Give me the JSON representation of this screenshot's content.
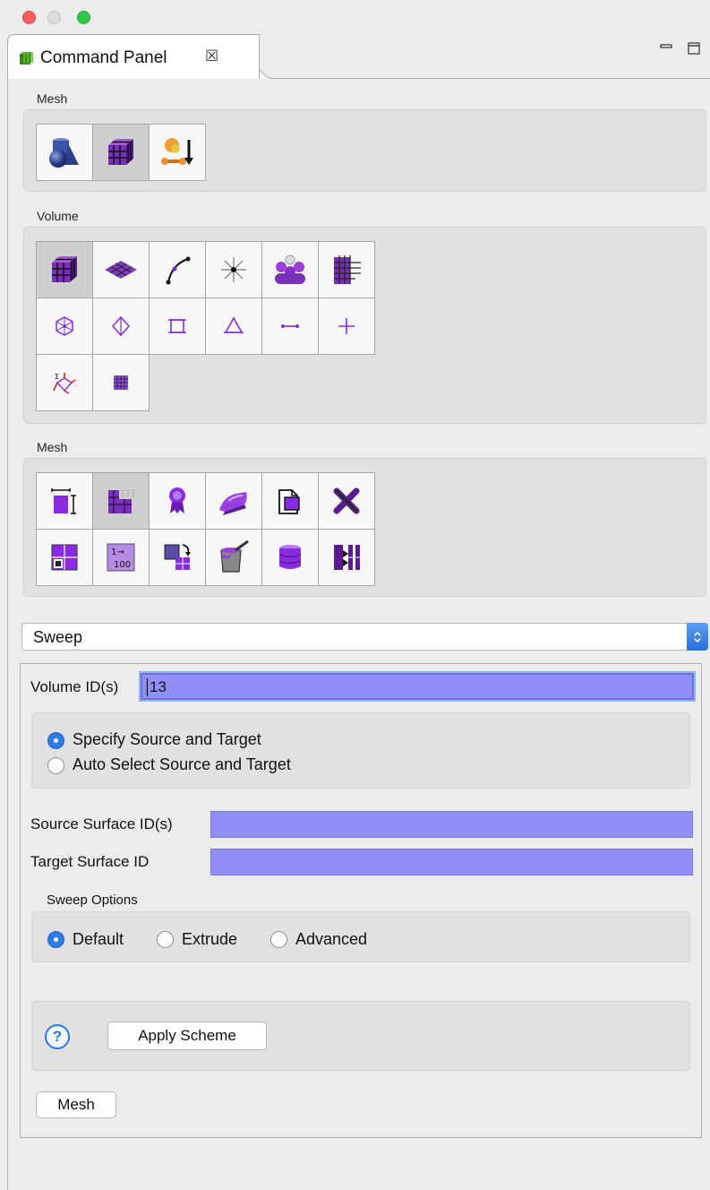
{
  "window": {
    "tab_title": "Command Panel",
    "tab_close_glyph": "☒"
  },
  "sections": {
    "top_label": "Mesh",
    "volume_label": "Volume",
    "mesh_label": "Mesh"
  },
  "toolbar_top": [
    {
      "icon": "geometry-shapes-icon",
      "pressed": false
    },
    {
      "icon": "mesh-cube-icon",
      "pressed": true
    },
    {
      "icon": "boundary-condition-icon",
      "pressed": false
    }
  ],
  "toolbar_volume": [
    {
      "icon": "volume-mesh-icon",
      "pressed": true
    },
    {
      "icon": "surface-mesh-icon",
      "pressed": false
    },
    {
      "icon": "curve-icon",
      "pressed": false
    },
    {
      "icon": "vertex-icon",
      "pressed": false
    },
    {
      "icon": "group-icon",
      "pressed": false
    },
    {
      "icon": "grid-icon",
      "pressed": false
    },
    {
      "icon": "node-icon",
      "pressed": false
    },
    {
      "icon": "edge-node-icon",
      "pressed": false
    },
    {
      "icon": "quad-node-icon",
      "pressed": false
    },
    {
      "icon": "tri-node-icon",
      "pressed": false
    },
    {
      "icon": "bar-node-icon",
      "pressed": false
    },
    {
      "icon": "point-node-icon",
      "pressed": false
    },
    {
      "icon": "sum-vector-icon",
      "pressed": false
    },
    {
      "icon": "hex-grid-icon",
      "pressed": false
    }
  ],
  "toolbar_mesh": [
    {
      "icon": "interval-icon",
      "pressed": false
    },
    {
      "icon": "scheme-icon",
      "pressed": true
    },
    {
      "icon": "quality-award-icon",
      "pressed": false
    },
    {
      "icon": "smooth-iron-icon",
      "pressed": false
    },
    {
      "icon": "copy-document-icon",
      "pressed": false
    },
    {
      "icon": "delete-x-icon",
      "pressed": false
    },
    {
      "icon": "refine-icon",
      "pressed": false
    },
    {
      "icon": "renumber-icon",
      "pressed": false
    },
    {
      "icon": "convert-icon",
      "pressed": false
    },
    {
      "icon": "paint-bucket-icon",
      "pressed": false
    },
    {
      "icon": "layers-cylinder-icon",
      "pressed": false
    },
    {
      "icon": "split-icon",
      "pressed": false
    }
  ],
  "scheme_select": {
    "value": "Sweep"
  },
  "form": {
    "volume_label": "Volume ID(s)",
    "volume_value": "13",
    "radio1": "Specify Source and Target",
    "radio2": "Auto Select Source and Target",
    "source_label": "Source Surface ID(s)",
    "source_value": "",
    "target_label": "Target Surface ID",
    "target_value": "",
    "options_label": "Sweep Options",
    "opt_default": "Default",
    "opt_extrude": "Extrude",
    "opt_advanced": "Advanced",
    "help": "?",
    "apply": "Apply Scheme",
    "mesh": "Mesh"
  },
  "colors": {
    "accent": "#2f7be6",
    "field": "#8f8ff7",
    "icon_purple": "#8a2be2"
  }
}
